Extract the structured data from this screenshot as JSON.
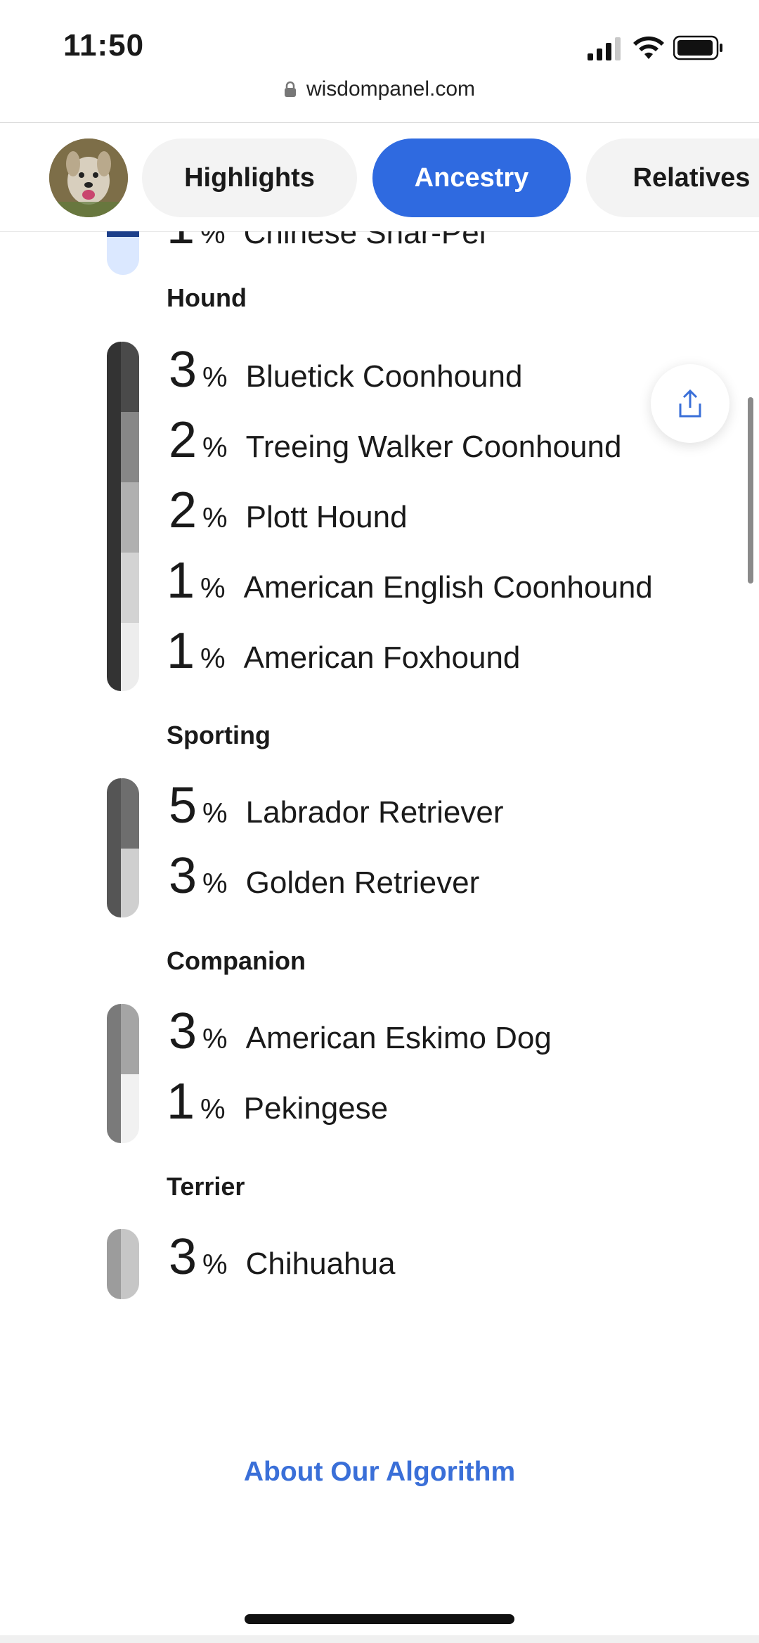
{
  "status_bar": {
    "time": "11:50"
  },
  "browser": {
    "url": "wisdompanel.com"
  },
  "tabs": [
    {
      "label": "Highlights",
      "active": false
    },
    {
      "label": "Ancestry",
      "active": true
    },
    {
      "label": "Relatives",
      "active": false
    }
  ],
  "partial_row": {
    "percent": "1",
    "pct_sign": "%",
    "breed": "Chinese Shar-Pei"
  },
  "groups": [
    {
      "title": "Hound",
      "breeds": [
        {
          "percent": "3",
          "pct_sign": "%",
          "name": "Bluetick Coonhound"
        },
        {
          "percent": "2",
          "pct_sign": "%",
          "name": "Treeing Walker Coonhound"
        },
        {
          "percent": "2",
          "pct_sign": "%",
          "name": "Plott Hound"
        },
        {
          "percent": "1",
          "pct_sign": "%",
          "name": "American English Coonhound"
        },
        {
          "percent": "1",
          "pct_sign": "%",
          "name": "American Foxhound"
        }
      ]
    },
    {
      "title": "Sporting",
      "breeds": [
        {
          "percent": "5",
          "pct_sign": "%",
          "name": "Labrador Retriever"
        },
        {
          "percent": "3",
          "pct_sign": "%",
          "name": "Golden Retriever"
        }
      ]
    },
    {
      "title": "Companion",
      "breeds": [
        {
          "percent": "3",
          "pct_sign": "%",
          "name": "American Eskimo Dog"
        },
        {
          "percent": "1",
          "pct_sign": "%",
          "name": "Pekingese"
        }
      ]
    },
    {
      "title": "Terrier",
      "breeds": [
        {
          "percent": "3",
          "pct_sign": "%",
          "name": "Chihuahua"
        }
      ]
    }
  ],
  "footer": {
    "about_link": "About Our Algorithm"
  },
  "colors": {
    "accent": "#2f6ae0",
    "link": "#3a6fd8",
    "hound_palette": [
      "#4a4a4a",
      "#878787",
      "#b0b0b0",
      "#d3d3d3",
      "#ededed"
    ],
    "sporting_palette": [
      "#6e6e6e",
      "#cfcfcf"
    ],
    "companion_palette": [
      "#a5a5a5",
      "#f1f1f1"
    ],
    "terrier_palette": [
      "#c6c6c6"
    ],
    "partial_palette": [
      "#f0f6ff",
      "#1c3f8a"
    ]
  },
  "icons": [
    "lock-icon",
    "share-icon",
    "signal-icon",
    "wifi-icon",
    "battery-icon"
  ]
}
